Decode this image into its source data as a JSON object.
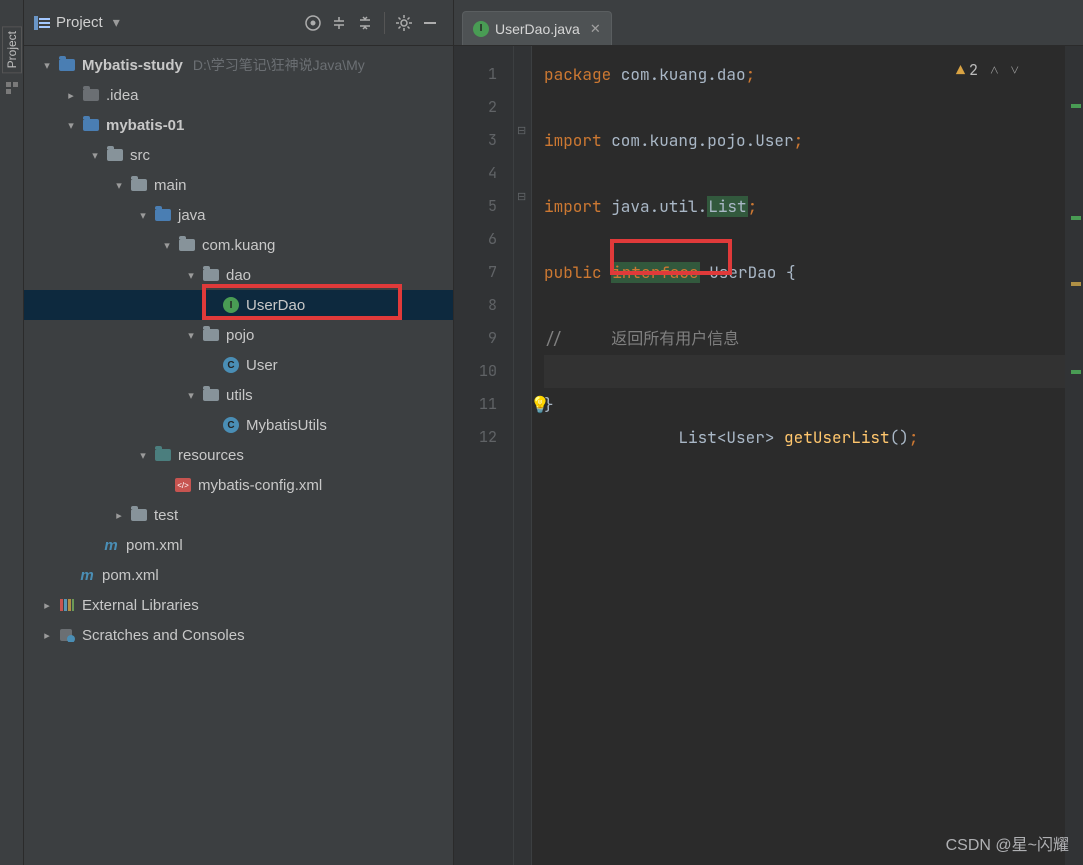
{
  "ribbon": {
    "label": "Project"
  },
  "panel": {
    "title": "Project",
    "toolbar": {
      "target_tip": "Select Opened File",
      "expand_tip": "Expand All",
      "collapse_tip": "Collapse All",
      "settings_tip": "Settings",
      "hide_tip": "Hide"
    }
  },
  "tree": {
    "root": {
      "label": "Mybatis-study",
      "hint": "D:\\学习笔记\\狂神说Java\\My"
    },
    "idea": ".idea",
    "mod1": "mybatis-01",
    "src": "src",
    "main": "main",
    "java": "java",
    "pkg": "com.kuang",
    "dao": "dao",
    "userdao": "UserDao",
    "pojo": "pojo",
    "user": "User",
    "utils": "utils",
    "mybatisutils": "MybatisUtils",
    "resources": "resources",
    "mybatiscfg": "mybatis-config.xml",
    "test": "test",
    "pom1": "pom.xml",
    "pom2": "pom.xml",
    "extlib": "External Libraries",
    "scratch": "Scratches and Consoles"
  },
  "tab": {
    "label": "UserDao.java",
    "icon_letter": "I"
  },
  "warning": {
    "count": "2"
  },
  "code": {
    "l1a": "package",
    "l1b": " com.kuang.dao",
    "l1c": ";",
    "l3a": "import",
    "l3b": " com.kuang.pojo.User",
    "l3c": ";",
    "l5a": "import",
    "l5b": " java.util.",
    "l5c": "List",
    "l5d": ";",
    "l7a": "public ",
    "l7b": "interface",
    "l7c": " UserDao {",
    "l9a": "//     返回所有用户信息",
    "l10a": "List",
    "l10b": "<User> ",
    "l10c": "getUserList",
    "l10d": "()",
    "l10e": ";",
    "l11a": "}"
  },
  "gutter": [
    "1",
    "2",
    "3",
    "4",
    "5",
    "6",
    "7",
    "8",
    "9",
    "10",
    "11",
    "12"
  ],
  "watermark": "CSDN @星~闪耀"
}
